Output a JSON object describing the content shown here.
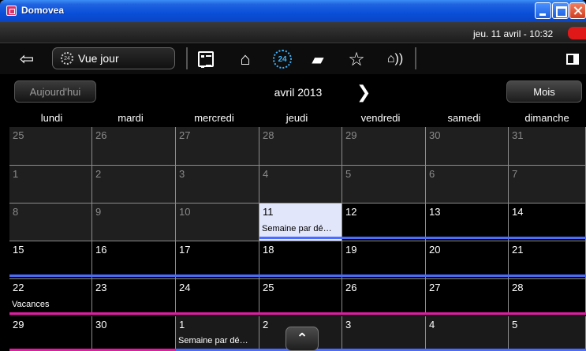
{
  "window": {
    "title": "Domovea"
  },
  "status": {
    "datetime": "jeu. 11 avril - 10:32"
  },
  "toolbar": {
    "view_selector": "Vue jour",
    "icons": [
      "back-arrow-icon",
      "day-view-icon",
      "list-icon",
      "home-icon",
      "24h-icon",
      "camera-icon",
      "favorites-star-icon",
      "alarm-icon",
      "exit-door-icon"
    ]
  },
  "nav": {
    "today_label": "Aujourd'hui",
    "month_label": "avril 2013",
    "next_label": "❯",
    "mode_label": "Mois"
  },
  "weekdays": [
    "lundi",
    "mardi",
    "mercredi",
    "jeudi",
    "vendredi",
    "samedi",
    "dimanche"
  ],
  "calendar": {
    "weeks": [
      [
        "25",
        "26",
        "27",
        "28",
        "29",
        "30",
        "31"
      ],
      [
        "1",
        "2",
        "3",
        "4",
        "5",
        "6",
        "7"
      ],
      [
        "8",
        "9",
        "10",
        "11",
        "12",
        "13",
        "14"
      ],
      [
        "15",
        "16",
        "17",
        "18",
        "19",
        "20",
        "21"
      ],
      [
        "22",
        "23",
        "24",
        "25",
        "26",
        "27",
        "28"
      ],
      [
        "29",
        "30",
        "1",
        "2",
        "3",
        "4",
        "5"
      ]
    ],
    "today": "11",
    "events": {
      "semaine_1": "Semaine par dé…",
      "vacances": "Vacances",
      "semaine_2": "Semaine par dé…"
    },
    "colors": {
      "today_bg": "#e2e6fa",
      "blue_event": "#4a6cff",
      "magenta_event": "#e21ca4"
    }
  }
}
